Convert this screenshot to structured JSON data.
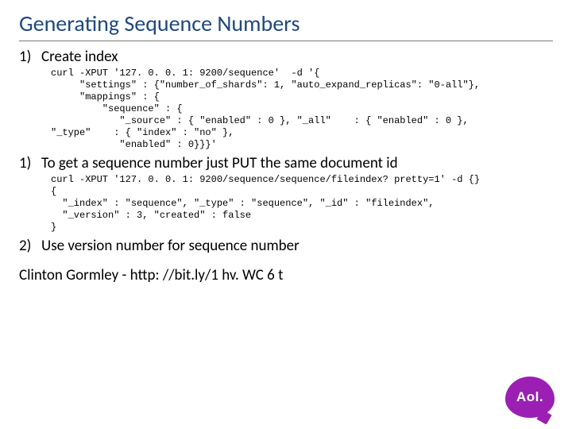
{
  "title": "Generating Sequence Numbers",
  "items": [
    {
      "num": "1)",
      "text": "Create index"
    },
    {
      "num": "1)",
      "text": "To get a sequence number just PUT the same document id"
    },
    {
      "num": "2)",
      "text": "Use version number for sequence number"
    }
  ],
  "code1": "curl -XPUT '127. 0. 0. 1: 9200/sequence'  -d '{\n     \"settings\" : {\"number_of_shards\": 1, \"auto_expand_replicas\": \"0-all\"},\n     \"mappings\" : {\n         \"sequence\" : {\n            \"_source\" : { \"enabled\" : 0 }, \"_all\"    : { \"enabled\" : 0 },\n\"_type\"    : { \"index\" : \"no\" },\n            \"enabled\" : 0}}}'",
  "code2": "curl -XPUT '127. 0. 0. 1: 9200/sequence/sequence/fileindex? pretty=1' -d {}\n{\n  \"_index\" : \"sequence\", \"_type\" : \"sequence\", \"_id\" : \"fileindex\",\n  \"_version\" : 3, \"created\" : false\n}",
  "author": "Clinton Gormley - http: //bit.ly/1 hv. WC 6 t",
  "logo_text": "Aol.",
  "brand_color": "#9b1fb3"
}
